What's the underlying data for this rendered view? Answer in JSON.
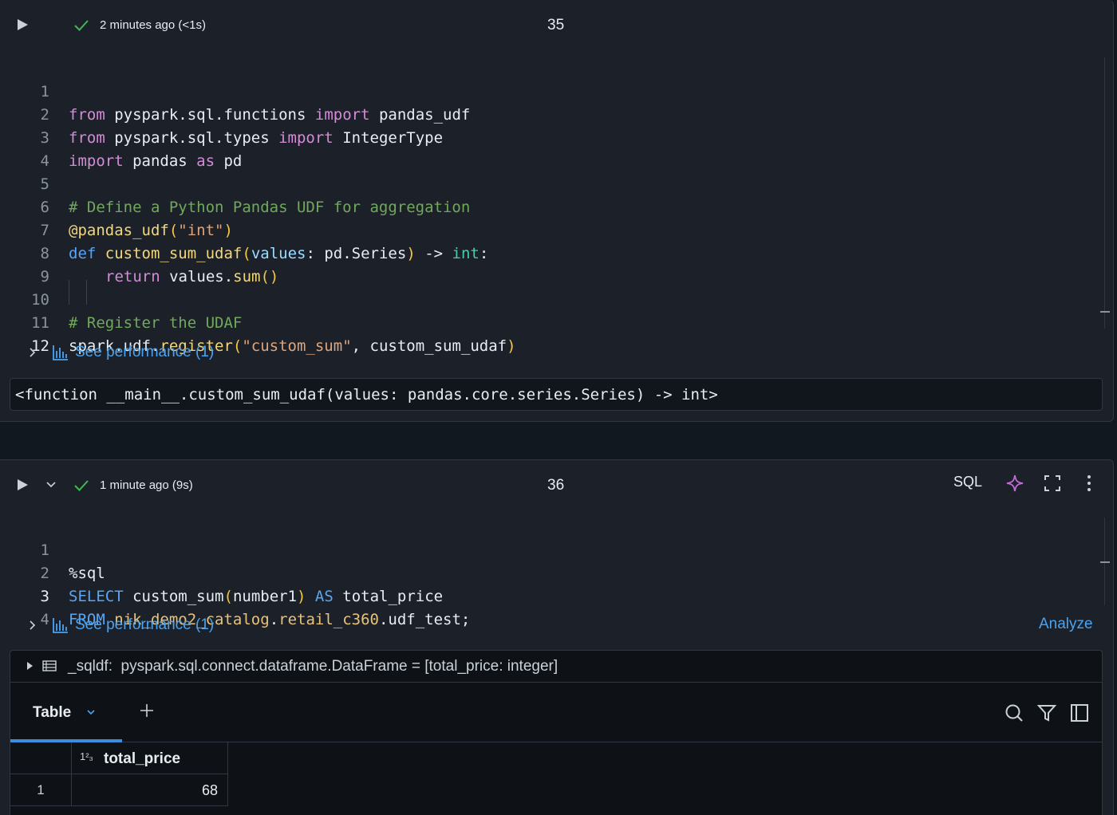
{
  "cells": [
    {
      "status": "2 minutes ago (<1s)",
      "number": "35",
      "line_numbers": [
        "1",
        "2",
        "3",
        "4",
        "5",
        "6",
        "7",
        "8",
        "9",
        "10",
        "11",
        "12"
      ],
      "performance_label": "See performance (1)",
      "output": "<function __main__.custom_sum_udaf(values: pandas.core.series.Series) -> int>"
    },
    {
      "status": "1 minute ago (9s)",
      "number": "36",
      "language": "SQL",
      "line_numbers": [
        "1",
        "2",
        "3",
        "4"
      ],
      "performance_label": "See performance (1)",
      "analyze_label": "Analyze",
      "dataframe_label": "_sqldf:",
      "dataframe_type": "pyspark.sql.connect.dataframe.DataFrame = [total_price: integer]",
      "result": {
        "tab_label": "Table",
        "columns": [
          {
            "name": "total_price",
            "type_icon": "1²₃"
          }
        ],
        "rows": [
          {
            "index": "1",
            "values": [
              "68"
            ]
          }
        ]
      }
    }
  ],
  "code35": {
    "l1": [
      "from",
      " pyspark.sql.functions ",
      "import",
      " pandas_udf"
    ],
    "l2": [
      "from",
      " pyspark.sql.types ",
      "import",
      " IntegerType"
    ],
    "l3": [
      "import",
      " pandas ",
      "as",
      " pd"
    ],
    "l5": "# Define a Python Pandas UDF for aggregation",
    "l6": [
      "@pandas_udf",
      "(",
      "\"int\"",
      ")"
    ],
    "l7": [
      "def",
      " ",
      "custom_sum_udaf",
      "(",
      "values",
      ": pd.Series",
      ")",
      " -> ",
      "int",
      ":"
    ],
    "l8": [
      "return",
      " values.",
      "sum",
      "()"
    ],
    "l10": "# Register the UDAF",
    "l11": [
      "spark.udf.",
      "register",
      "(",
      "\"custom_sum\"",
      ", custom_sum_udaf",
      ")"
    ]
  },
  "code36": {
    "l1": "%sql",
    "l2": [
      "SELECT",
      " custom_sum",
      "(",
      "number1",
      ")",
      " ",
      "AS",
      " total_price"
    ],
    "l3": [
      "FROM",
      " ",
      "nik_demo2_catalog",
      ".",
      "retail_c360",
      ".udf_test;"
    ]
  },
  "icons": {
    "run": "play-icon",
    "check": "check-icon",
    "ai": "sparkle-icon",
    "fullscreen": "fullscreen-icon",
    "more": "more-icon",
    "search": "search-icon",
    "filter": "filter-icon",
    "panel": "panel-icon"
  },
  "colors": {
    "accent": "#4aa3f0",
    "success": "#3fb950",
    "sparkle": "#c36ad6"
  }
}
